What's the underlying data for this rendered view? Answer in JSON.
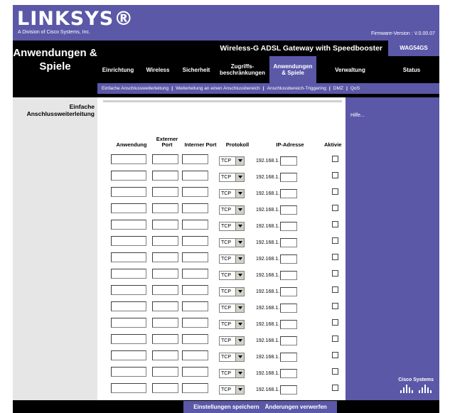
{
  "brand": {
    "logo_text": "LINKSYS®",
    "division": "A Division of Cisco Systems, Inc.",
    "firmware": "Firmware-Version : V.0.00.07"
  },
  "header": {
    "section_title_line1": "Anwendungen &",
    "section_title_line2": "Spiele",
    "product_name": "Wireless-G ADSL Gateway with Speedbooster",
    "model": "WAG54GS"
  },
  "nav": {
    "tabs": [
      {
        "label": "Einrichtung"
      },
      {
        "label": "Wireless"
      },
      {
        "label": "Sicherheit"
      },
      {
        "label": "Zugriffs-beschränkungen"
      },
      {
        "label": "Anwendungen & Spiele",
        "active": true
      },
      {
        "label": "Verwaltung"
      },
      {
        "label": "Status"
      }
    ],
    "subtabs": [
      {
        "label": "Einfache Anschlussweiterleitung",
        "active": true
      },
      {
        "label": "Weiterleitung an einen Anschlussbereich"
      },
      {
        "label": "Anschlussbereich-Triggering"
      },
      {
        "label": "DMZ"
      },
      {
        "label": "QoS"
      }
    ],
    "separator": "|"
  },
  "sidebar": {
    "label_line1": "Einfache",
    "label_line2": "Anschlussweiterleitung"
  },
  "table": {
    "headers": {
      "app": "Anwendung",
      "ext_port": "Externer Port",
      "int_port": "Interner Port",
      "protocol": "Protokoll",
      "ip": "IP-Adresse",
      "enabled": "Aktiviert"
    },
    "protocol_value": "TCP",
    "ip_prefix": "192.168.1.",
    "row_count": 15
  },
  "help": {
    "label": "Hilfe..."
  },
  "footer": {
    "save": "Einstellungen speichern",
    "discard": "Änderungen verwerfen"
  },
  "cisco": {
    "label": "Cisco Systems"
  },
  "colors": {
    "accent": "#5b58a8",
    "black": "#000000",
    "sidebar": "#e6e6e6"
  }
}
